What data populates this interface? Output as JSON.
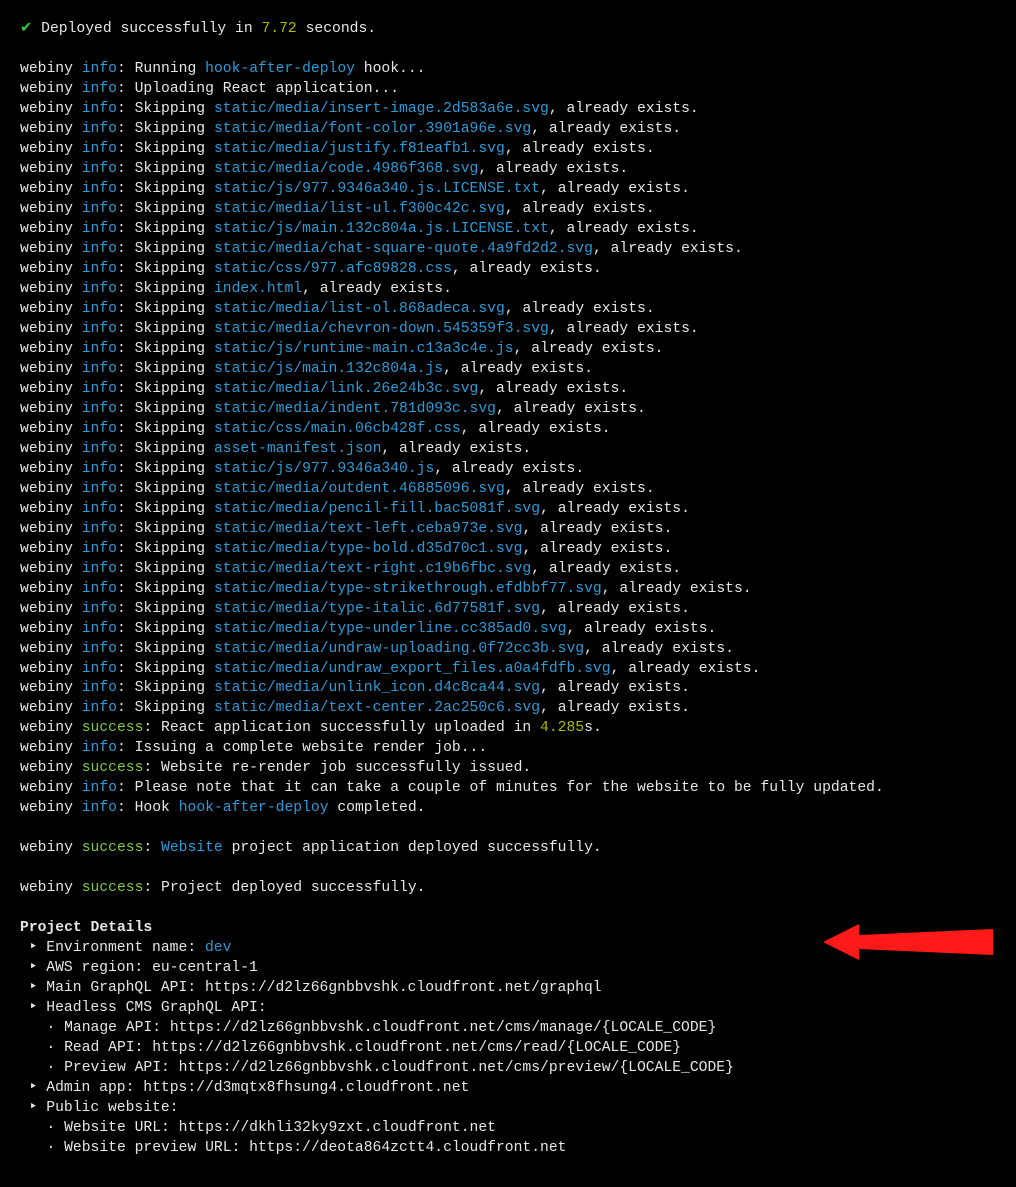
{
  "meta": {
    "prefix": "webiny",
    "levels": {
      "info": "info",
      "success": "success"
    },
    "checkmark": "✔"
  },
  "deployed": {
    "pre": " Deployed successfully in ",
    "seconds": "7.72",
    "post": " seconds."
  },
  "lines": [
    {
      "level": "info",
      "pre": "Running ",
      "link": "hook-after-deploy",
      "post": " hook..."
    },
    {
      "level": "info",
      "pre": "Uploading React application...",
      "link": "",
      "post": ""
    },
    {
      "level": "info",
      "pre": "Skipping ",
      "link": "static/media/insert-image.2d583a6e.svg",
      "post": ", already exists."
    },
    {
      "level": "info",
      "pre": "Skipping ",
      "link": "static/media/font-color.3901a96e.svg",
      "post": ", already exists."
    },
    {
      "level": "info",
      "pre": "Skipping ",
      "link": "static/media/justify.f81eafb1.svg",
      "post": ", already exists."
    },
    {
      "level": "info",
      "pre": "Skipping ",
      "link": "static/media/code.4986f368.svg",
      "post": ", already exists."
    },
    {
      "level": "info",
      "pre": "Skipping ",
      "link": "static/js/977.9346a340.js.LICENSE.txt",
      "post": ", already exists."
    },
    {
      "level": "info",
      "pre": "Skipping ",
      "link": "static/media/list-ul.f300c42c.svg",
      "post": ", already exists."
    },
    {
      "level": "info",
      "pre": "Skipping ",
      "link": "static/js/main.132c804a.js.LICENSE.txt",
      "post": ", already exists."
    },
    {
      "level": "info",
      "pre": "Skipping ",
      "link": "static/media/chat-square-quote.4a9fd2d2.svg",
      "post": ", already exists."
    },
    {
      "level": "info",
      "pre": "Skipping ",
      "link": "static/css/977.afc89828.css",
      "post": ", already exists."
    },
    {
      "level": "info",
      "pre": "Skipping ",
      "link": "index.html",
      "post": ", already exists."
    },
    {
      "level": "info",
      "pre": "Skipping ",
      "link": "static/media/list-ol.868adeca.svg",
      "post": ", already exists."
    },
    {
      "level": "info",
      "pre": "Skipping ",
      "link": "static/media/chevron-down.545359f3.svg",
      "post": ", already exists."
    },
    {
      "level": "info",
      "pre": "Skipping ",
      "link": "static/js/runtime-main.c13a3c4e.js",
      "post": ", already exists."
    },
    {
      "level": "info",
      "pre": "Skipping ",
      "link": "static/js/main.132c804a.js",
      "post": ", already exists."
    },
    {
      "level": "info",
      "pre": "Skipping ",
      "link": "static/media/link.26e24b3c.svg",
      "post": ", already exists."
    },
    {
      "level": "info",
      "pre": "Skipping ",
      "link": "static/media/indent.781d093c.svg",
      "post": ", already exists."
    },
    {
      "level": "info",
      "pre": "Skipping ",
      "link": "static/css/main.06cb428f.css",
      "post": ", already exists."
    },
    {
      "level": "info",
      "pre": "Skipping ",
      "link": "asset-manifest.json",
      "post": ", already exists."
    },
    {
      "level": "info",
      "pre": "Skipping ",
      "link": "static/js/977.9346a340.js",
      "post": ", already exists."
    },
    {
      "level": "info",
      "pre": "Skipping ",
      "link": "static/media/outdent.46885096.svg",
      "post": ", already exists."
    },
    {
      "level": "info",
      "pre": "Skipping ",
      "link": "static/media/pencil-fill.bac5081f.svg",
      "post": ", already exists."
    },
    {
      "level": "info",
      "pre": "Skipping ",
      "link": "static/media/text-left.ceba973e.svg",
      "post": ", already exists."
    },
    {
      "level": "info",
      "pre": "Skipping ",
      "link": "static/media/type-bold.d35d70c1.svg",
      "post": ", already exists."
    },
    {
      "level": "info",
      "pre": "Skipping ",
      "link": "static/media/text-right.c19b6fbc.svg",
      "post": ", already exists."
    },
    {
      "level": "info",
      "pre": "Skipping ",
      "link": "static/media/type-strikethrough.efdbbf77.svg",
      "post": ", already exists."
    },
    {
      "level": "info",
      "pre": "Skipping ",
      "link": "static/media/type-italic.6d77581f.svg",
      "post": ", already exists."
    },
    {
      "level": "info",
      "pre": "Skipping ",
      "link": "static/media/type-underline.cc385ad0.svg",
      "post": ", already exists."
    },
    {
      "level": "info",
      "pre": "Skipping ",
      "link": "static/media/undraw-uploading.0f72cc3b.svg",
      "post": ", already exists."
    },
    {
      "level": "info",
      "pre": "Skipping ",
      "link": "static/media/undraw_export_files.a0a4fdfb.svg",
      "post": ", already exists."
    },
    {
      "level": "info",
      "pre": "Skipping ",
      "link": "static/media/unlink_icon.d4c8ca44.svg",
      "post": ", already exists."
    },
    {
      "level": "info",
      "pre": "Skipping ",
      "link": "static/media/text-center.2ac250c6.svg",
      "post": ", already exists."
    },
    {
      "level": "success",
      "pre": "React application successfully uploaded in ",
      "link": "",
      "num": "4.285",
      "numpost": "s.",
      "post": ""
    },
    {
      "level": "info",
      "pre": "Issuing a complete website render job...",
      "link": "",
      "post": ""
    },
    {
      "level": "success",
      "pre": "Website re-render job successfully issued.",
      "link": "",
      "post": ""
    },
    {
      "level": "info",
      "pre": "Please note that it can take a couple of minutes for the website to be fully updated.",
      "link": "",
      "post": ""
    },
    {
      "level": "info",
      "pre": "Hook ",
      "link": "hook-after-deploy",
      "post": " completed."
    }
  ],
  "final1": {
    "level": "success",
    "link": "Website",
    "post": " project application deployed successfully."
  },
  "final2": {
    "level": "success",
    "text": "Project deployed successfully."
  },
  "details": {
    "title": "Project Details",
    "bullet1": " ‣ ",
    "bullet2": "   · ",
    "items": [
      {
        "label": "Environment name: ",
        "valueClass": "blue",
        "value": "dev"
      },
      {
        "label": "AWS region: ",
        "value": "eu-central-1"
      },
      {
        "label": "Main GraphQL API: ",
        "value": "https://d2lz66gnbbvshk.cloudfront.net/graphql"
      },
      {
        "label": "Headless CMS GraphQL API:",
        "value": "",
        "children": [
          {
            "label": "Manage API: ",
            "value": "https://d2lz66gnbbvshk.cloudfront.net/cms/manage/{LOCALE_CODE}"
          },
          {
            "label": "Read API: ",
            "value": "https://d2lz66gnbbvshk.cloudfront.net/cms/read/{LOCALE_CODE}"
          },
          {
            "label": "Preview API: ",
            "value": "https://d2lz66gnbbvshk.cloudfront.net/cms/preview/{LOCALE_CODE}"
          }
        ]
      },
      {
        "label": "Admin app: ",
        "value": "https://d3mqtx8fhsung4.cloudfront.net"
      },
      {
        "label": "Public website:",
        "value": "",
        "children": [
          {
            "label": "Website URL: ",
            "value": "https://dkhli32ky9zxt.cloudfront.net"
          },
          {
            "label": "Website preview URL: ",
            "value": "https://deota864zctt4.cloudfront.net"
          }
        ]
      }
    ]
  }
}
